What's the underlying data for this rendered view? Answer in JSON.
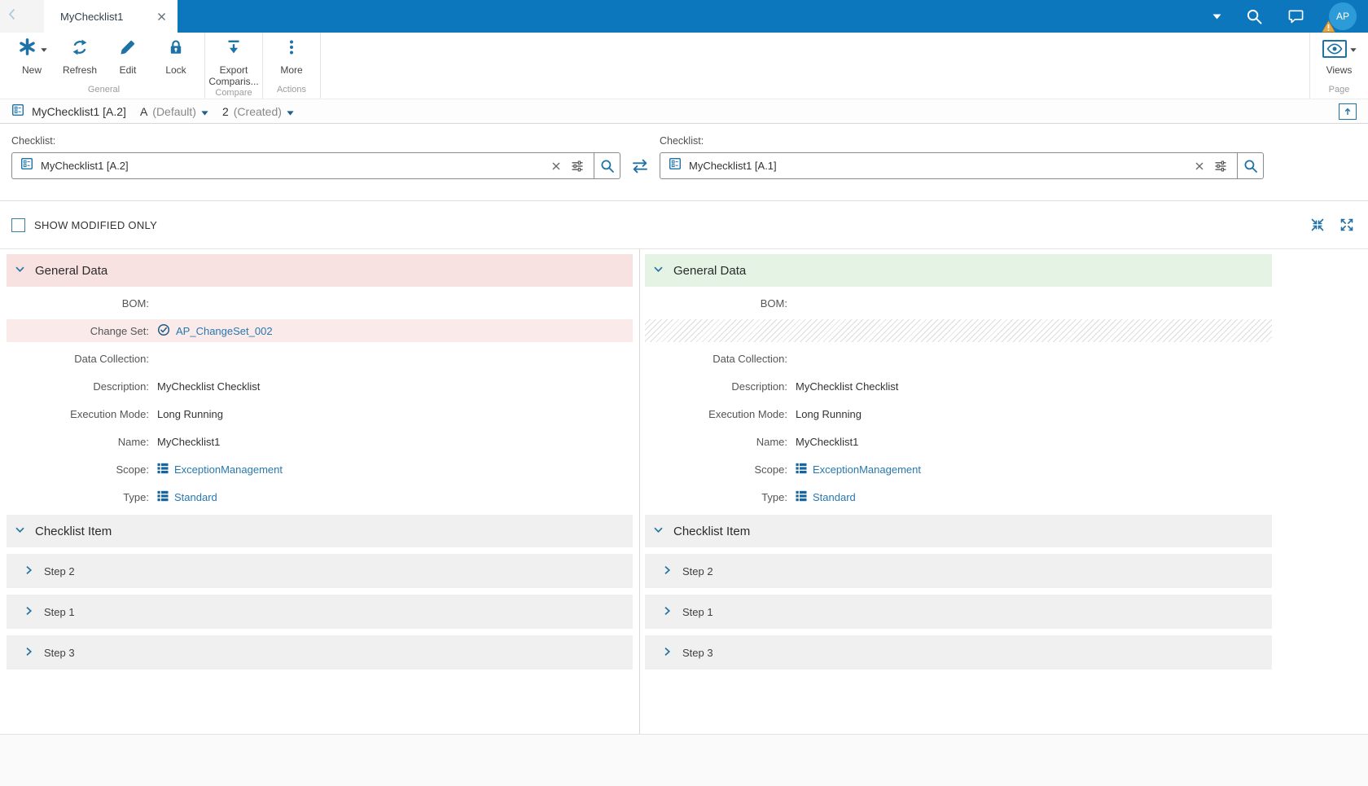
{
  "colors": {
    "brand_blue": "#0d77bd",
    "icon_blue": "#1e72a4",
    "link_blue": "#2878ae",
    "modified_left_bg": "#f8e1e1",
    "modified_right_bg": "#e4f3e4",
    "avatar_blue": "#2d9bd8",
    "warning_orange": "#eda73f"
  },
  "topbar": {
    "tab_title": "MyChecklist1",
    "avatar_initials": "AP"
  },
  "toolbar": {
    "buttons": {
      "new": "New",
      "refresh": "Refresh",
      "edit": "Edit",
      "lock": "Lock",
      "export": "Export Comparis...",
      "more": "More",
      "views": "Views"
    },
    "groups": {
      "general": "General",
      "compare": "Compare",
      "actions": "Actions",
      "page": "Page"
    }
  },
  "breadcrumb": {
    "title": "MyChecklist1 [A.2]",
    "revision": "A",
    "revision_note": "(Default)",
    "version": "2",
    "version_note": "(Created)"
  },
  "compare": {
    "left_label": "Checklist:",
    "left_value": "MyChecklist1 [A.2]",
    "right_label": "Checklist:",
    "right_value": "MyChecklist1 [A.1]",
    "show_modified": "SHOW MODIFIED ONLY"
  },
  "left_panel": {
    "general_header": "General Data",
    "fields": {
      "bom_label": "BOM:",
      "changeset_label": "Change Set:",
      "changeset_value": "AP_ChangeSet_002",
      "datacollection_label": "Data Collection:",
      "description_label": "Description:",
      "description_value": "MyChecklist Checklist",
      "execution_label": "Execution Mode:",
      "execution_value": "Long Running",
      "name_label": "Name:",
      "name_value": "MyChecklist1",
      "scope_label": "Scope:",
      "scope_value": "ExceptionManagement",
      "type_label": "Type:",
      "type_value": "Standard"
    },
    "items_header": "Checklist Item",
    "steps": [
      "Step 2",
      "Step 1",
      "Step 3"
    ]
  },
  "right_panel": {
    "general_header": "General Data",
    "fields": {
      "bom_label": "BOM:",
      "datacollection_label": "Data Collection:",
      "description_label": "Description:",
      "description_value": "MyChecklist Checklist",
      "execution_label": "Execution Mode:",
      "execution_value": "Long Running",
      "name_label": "Name:",
      "name_value": "MyChecklist1",
      "scope_label": "Scope:",
      "scope_value": "ExceptionManagement",
      "type_label": "Type:",
      "type_value": "Standard"
    },
    "items_header": "Checklist Item",
    "steps": [
      "Step 2",
      "Step 1",
      "Step 3"
    ]
  }
}
